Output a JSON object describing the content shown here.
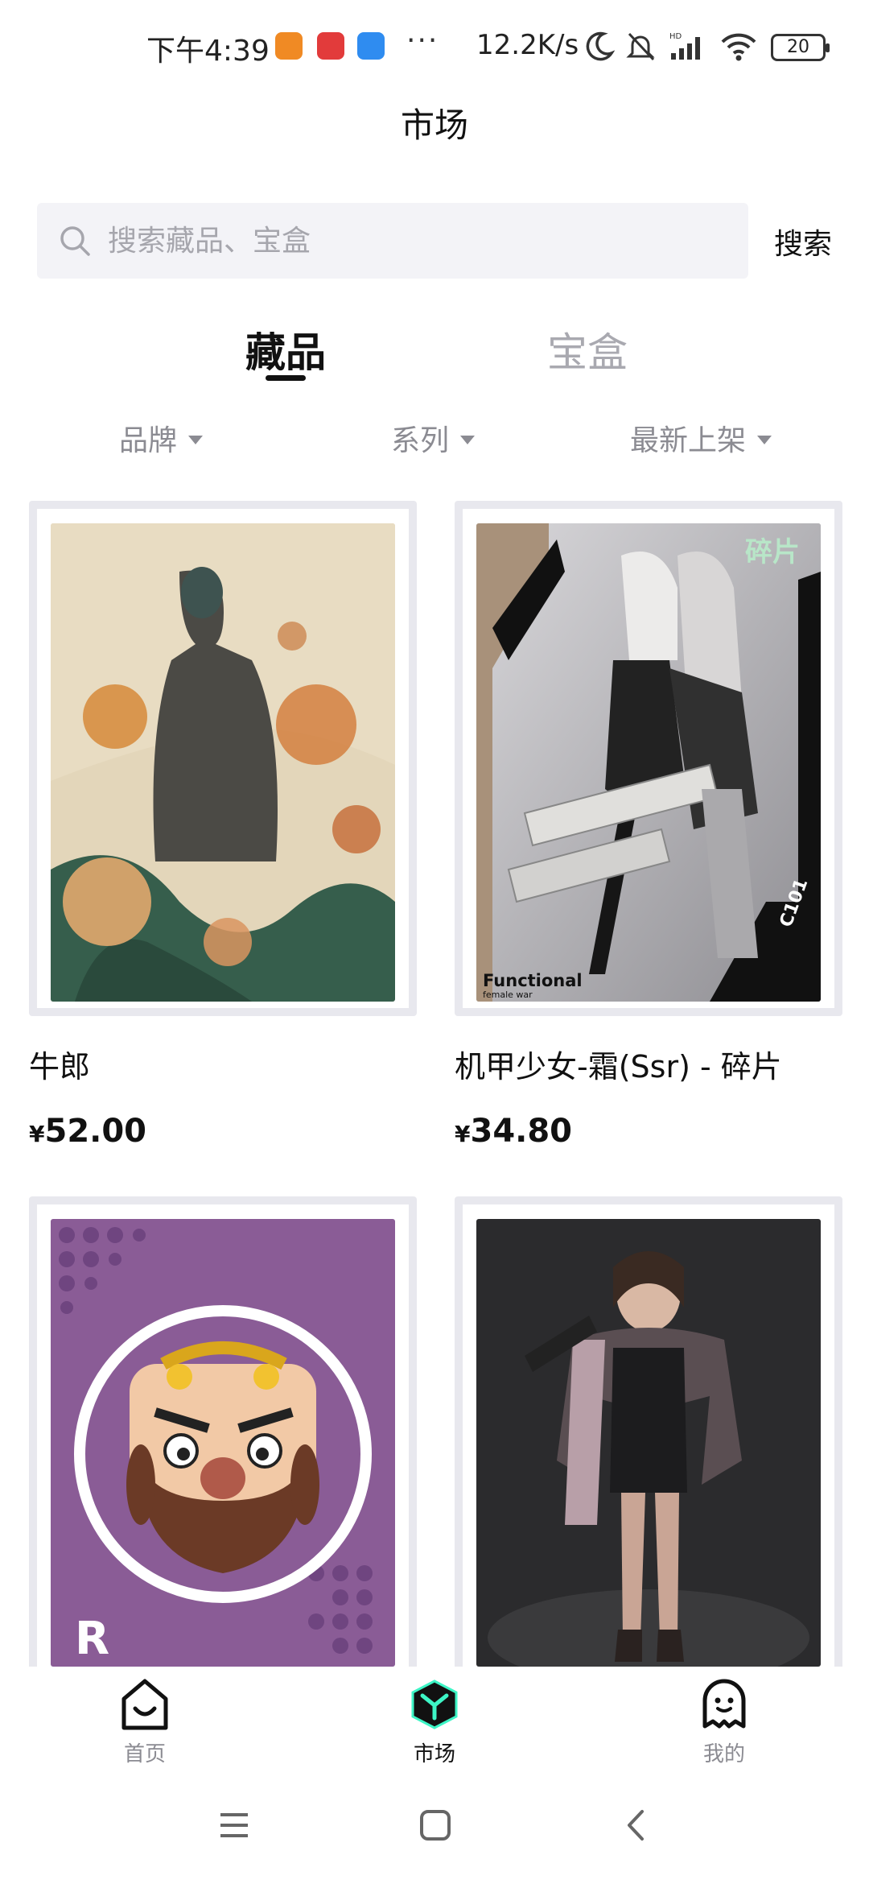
{
  "status_bar": {
    "time": "下午4:39",
    "net_speed": "12.2K/s",
    "battery": "20"
  },
  "header": {
    "title": "市场"
  },
  "search": {
    "placeholder": "搜索藏品、宝盒",
    "button_label": "搜索"
  },
  "tabs": [
    {
      "label": "藏品",
      "active": true
    },
    {
      "label": "宝盒",
      "active": false
    }
  ],
  "filters": [
    {
      "label": "品牌"
    },
    {
      "label": "系列"
    },
    {
      "label": "最新上架"
    }
  ],
  "items": [
    {
      "name": "牛郎",
      "currency": "¥",
      "price": "52.00"
    },
    {
      "name": "机甲少女-霜(Ssr) - 碎片",
      "currency": "¥",
      "price": "34.80",
      "badge": "碎片",
      "art_text": "Functional",
      "art_subtext": "female war",
      "art_code": "C101"
    },
    {
      "name": "",
      "currency": "",
      "price": "",
      "art_text": "R"
    },
    {
      "name": "",
      "currency": "",
      "price": ""
    }
  ],
  "tabbar": {
    "items": [
      {
        "label": "首页",
        "icon": "home-icon",
        "active": false
      },
      {
        "label": "市场",
        "icon": "cube-icon",
        "active": true
      },
      {
        "label": "我的",
        "icon": "ghost-icon",
        "active": false
      }
    ]
  },
  "colors": {
    "text_primary": "#111111",
    "text_muted": "#a9a9b0",
    "search_bg": "#f3f3f7",
    "card_frame": "#e8e8ee",
    "market_icon_accent": "#3df5c6"
  }
}
